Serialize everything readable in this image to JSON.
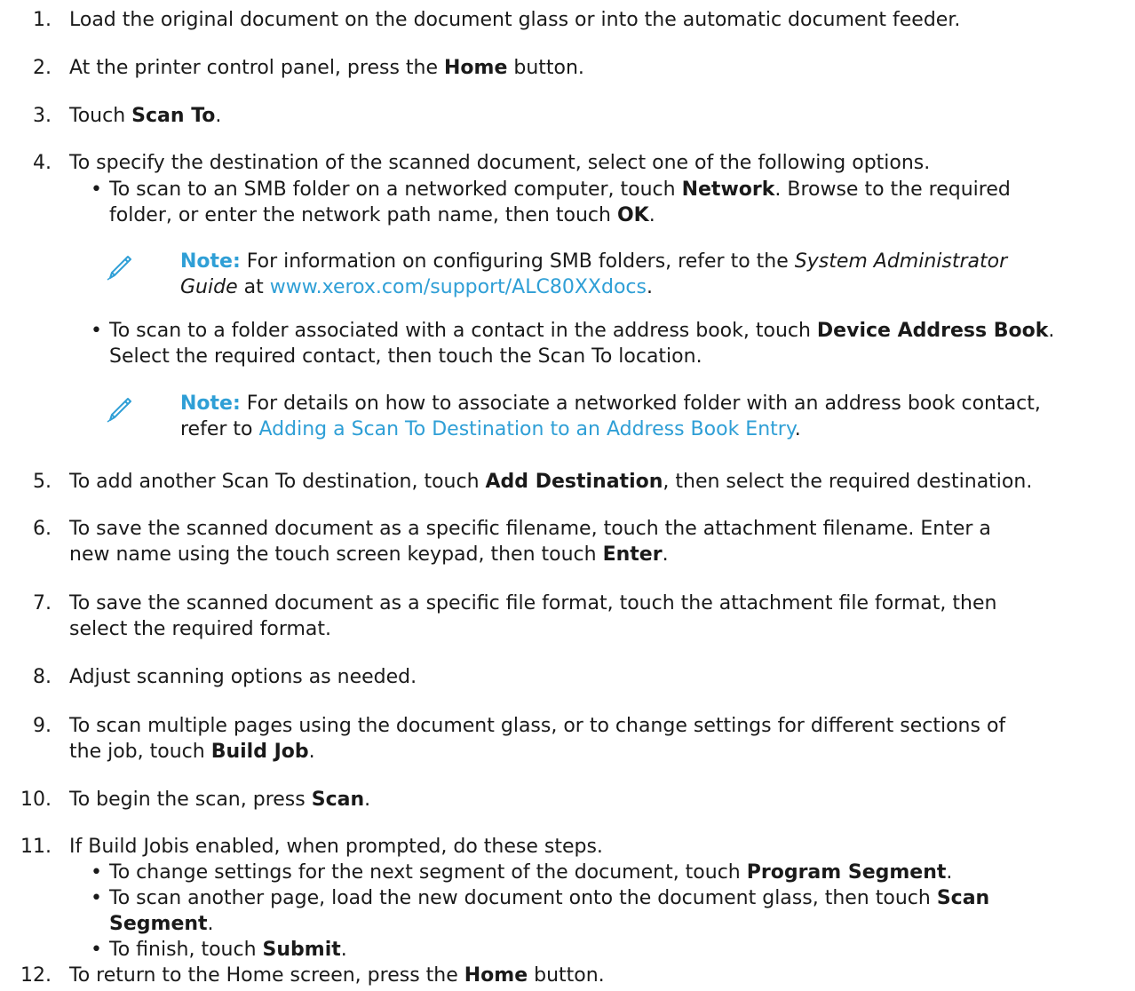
{
  "steps": [
    {
      "num": "1.",
      "text": "Load the original document on the document glass or into the automatic document feeder."
    },
    {
      "num": "2.",
      "a": "At the printer control panel, press the ",
      "b": "Home",
      "c": " button."
    },
    {
      "num": "3.",
      "a": "Touch ",
      "b": "Scan To",
      "c": "."
    },
    {
      "num": "4.",
      "text": "To specify the destination of the scanned document, select one of the following options.",
      "bullets": [
        {
          "l1a": "To scan to an SMB folder on a networked computer, touch ",
          "l1b": "Network",
          "l1c": ". Browse to the required",
          "l2a": "folder, or enter the network path name, then touch ",
          "l2b": "OK",
          "l2c": "."
        },
        {
          "l1a": "To scan to a folder associated with a contact in the address book, touch ",
          "l1b": "Device Address Book",
          "l1c": ".",
          "l2": "Select the required contact, then touch the Scan To location."
        }
      ],
      "notes": [
        {
          "label": "Note:",
          "l1a": " For information on configuring SMB folders, refer to the ",
          "l1i": "System Administrator",
          "l2i": "Guide",
          "l2a": " at ",
          "l2link": "www.xerox.com/support/ALC80XXdocs",
          "l2c": "."
        },
        {
          "label": "Note:",
          "l1a": " For details on how to associate a networked folder with an address book contact,",
          "l2a": "refer to ",
          "l2link": "Adding a Scan To Destination to an Address Book Entry",
          "l2c": "."
        }
      ]
    },
    {
      "num": "5.",
      "a": "To add another Scan To destination, touch ",
      "b": "Add Destination",
      "c": ", then select the required destination."
    },
    {
      "num": "6.",
      "l1": "To save the scanned document as a specific filename, touch the attachment filename. Enter a",
      "l2a": "new name using the touch screen keypad, then touch ",
      "l2b": "Enter",
      "l2c": "."
    },
    {
      "num": "7.",
      "l1": "To save the scanned document as a specific file format, touch the attachment file format, then",
      "l2": "select the required format."
    },
    {
      "num": "8.",
      "text": "Adjust scanning options as needed."
    },
    {
      "num": "9.",
      "l1": "To scan multiple pages using the document glass, or to change settings for different sections of",
      "l2a": "the job, touch ",
      "l2b": "Build Job",
      "l2c": "."
    },
    {
      "num": "10.",
      "a": "To begin the scan, press ",
      "b": "Scan",
      "c": "."
    },
    {
      "num": "11.",
      "text": "If Build Jobis enabled, when prompted, do these steps.",
      "bullets": [
        {
          "a": "To change settings for the next segment of the document, touch ",
          "b": "Program Segment",
          "c": "."
        },
        {
          "l1a": "To scan another page, load the new document onto the document glass, then touch ",
          "l1b": "Scan",
          "l2b": "Segment",
          "l2c": "."
        },
        {
          "a": "To finish, touch ",
          "b": "Submit",
          "c": "."
        }
      ]
    },
    {
      "num": "12.",
      "a": "To return to the Home screen, press the ",
      "b": "Home",
      "c": " button."
    }
  ],
  "bullet_glyph": "•",
  "colors": {
    "text": "#1a1a1a",
    "accent": "#2f9fd6"
  },
  "icons": {
    "note": "pencil-icon"
  }
}
